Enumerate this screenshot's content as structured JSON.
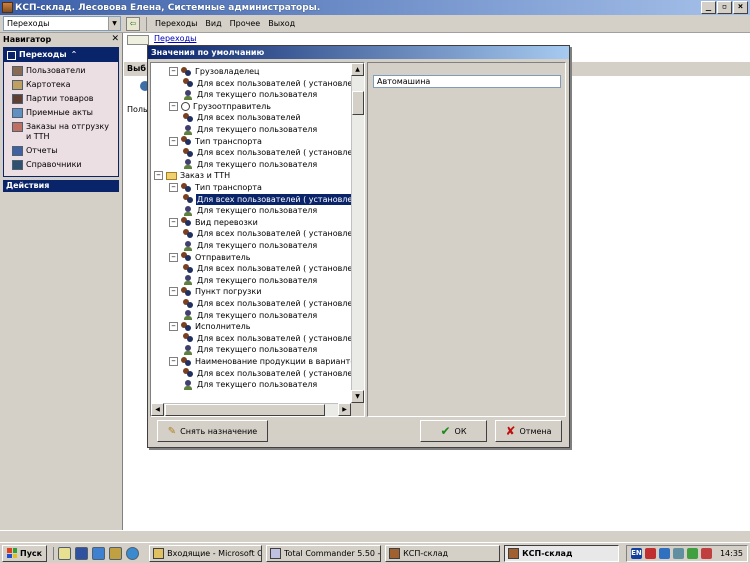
{
  "window": {
    "title": "КСП-склад. Лесовова Елена, Системные администраторы."
  },
  "menubar": {
    "combo_value": "Переходы",
    "items": [
      "Переходы",
      "Вид",
      "Прочее",
      "Выход"
    ]
  },
  "navigator": {
    "title": "Навигатор",
    "panel_title": "Переходы",
    "items": [
      "Пользователи",
      "Картотека",
      "Партии товаров",
      "Приемные акты",
      "Заказы на отгрузку и ТТН",
      "Отчеты",
      "Справочники"
    ],
    "actions_title": "Действия"
  },
  "main": {
    "tab_link": "Переходы",
    "label": "Выб",
    "text": "Польз"
  },
  "dialog": {
    "title": "Значения по умолчанию",
    "tree": [
      {
        "depth": 1,
        "expander": "⊟",
        "icon": "people",
        "label": "Грузовладелец"
      },
      {
        "depth": 2,
        "expander": "",
        "icon": "people",
        "label": "Для всех пользователей ( установлен"
      },
      {
        "depth": 2,
        "expander": "",
        "icon": "person",
        "label": "Для текущего пользователя"
      },
      {
        "depth": 1,
        "expander": "⊟",
        "icon": "circle",
        "label": "Грузоотправитель"
      },
      {
        "depth": 2,
        "expander": "",
        "icon": "people",
        "label": "Для всех пользователей"
      },
      {
        "depth": 2,
        "expander": "",
        "icon": "person",
        "label": "Для текущего пользователя"
      },
      {
        "depth": 1,
        "expander": "⊟",
        "icon": "people",
        "label": "Тип транспорта"
      },
      {
        "depth": 2,
        "expander": "",
        "icon": "people",
        "label": "Для всех пользователей ( установлен"
      },
      {
        "depth": 2,
        "expander": "",
        "icon": "person",
        "label": "Для текущего пользователя"
      },
      {
        "depth": 0,
        "expander": "⊟",
        "icon": "folder",
        "label": "Заказ и ТТН"
      },
      {
        "depth": 1,
        "expander": "⊟",
        "icon": "people",
        "label": "Тип транспорта"
      },
      {
        "depth": 2,
        "expander": "",
        "icon": "people",
        "label": "Для всех пользователей ( установлен",
        "selected": true
      },
      {
        "depth": 2,
        "expander": "",
        "icon": "person",
        "label": "Для текущего пользователя"
      },
      {
        "depth": 1,
        "expander": "⊟",
        "icon": "people",
        "label": "Вид перевозки"
      },
      {
        "depth": 2,
        "expander": "",
        "icon": "people",
        "label": "Для всех пользователей ( установлен"
      },
      {
        "depth": 2,
        "expander": "",
        "icon": "person",
        "label": "Для текущего пользователя"
      },
      {
        "depth": 1,
        "expander": "⊟",
        "icon": "people",
        "label": "Отправитель"
      },
      {
        "depth": 2,
        "expander": "",
        "icon": "people",
        "label": "Для всех пользователей ( установлен"
      },
      {
        "depth": 2,
        "expander": "",
        "icon": "person",
        "label": "Для текущего пользователя"
      },
      {
        "depth": 1,
        "expander": "⊟",
        "icon": "people",
        "label": "Пункт погрузки"
      },
      {
        "depth": 2,
        "expander": "",
        "icon": "people",
        "label": "Для всех пользователей ( установлен"
      },
      {
        "depth": 2,
        "expander": "",
        "icon": "person",
        "label": "Для текущего пользователя"
      },
      {
        "depth": 1,
        "expander": "⊟",
        "icon": "people",
        "label": "Исполнитель"
      },
      {
        "depth": 2,
        "expander": "",
        "icon": "people",
        "label": "Для всех пользователей ( установлен"
      },
      {
        "depth": 2,
        "expander": "",
        "icon": "person",
        "label": "Для текущего пользователя"
      },
      {
        "depth": 1,
        "expander": "⊟",
        "icon": "people",
        "label": "Наименование продукции в варианте для"
      },
      {
        "depth": 2,
        "expander": "",
        "icon": "people",
        "label": "Для всех пользователей ( установлен"
      },
      {
        "depth": 2,
        "expander": "",
        "icon": "person",
        "label": "Для текущего пользователя"
      }
    ],
    "value": "Автомашина",
    "clear_label": "Снять назначение",
    "ok_label": "ОК",
    "cancel_label": "Отмена"
  },
  "taskbar": {
    "start_label": "Пуск",
    "tasks": [
      {
        "label": "Входящие - Microsoft O...",
        "active": false
      },
      {
        "label": "Total Commander 5.50 - ...",
        "active": false
      },
      {
        "label": "КСП-склад",
        "active": false
      },
      {
        "label": "КСП-склад",
        "active": true
      }
    ],
    "lang": "EN",
    "clock": "14:35"
  }
}
